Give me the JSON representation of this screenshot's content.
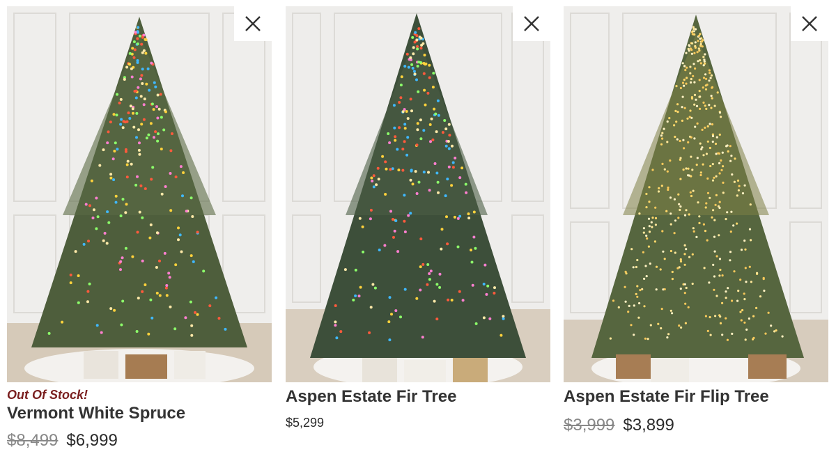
{
  "products": [
    {
      "stock_status": "Out Of Stock!",
      "name": "Vermont White Spruce",
      "old_price": "$8,499",
      "price": "$6,999",
      "image_alt": "Vermont White Spruce",
      "light_style": "multicolor"
    },
    {
      "stock_status": "",
      "name": "Aspen Estate Fir Tree",
      "old_price": "",
      "price": "$5,299",
      "image_alt": "Aspen Estate Fir Tree",
      "light_style": "multicolor"
    },
    {
      "stock_status": "",
      "name": "Aspen Estate Fir Flip Tree",
      "old_price": "$3,999",
      "price": "$3,899",
      "image_alt": "Aspen Estate Fir Flip Tree",
      "light_style": "warm-white"
    }
  ],
  "icons": {
    "remove": "close-icon"
  },
  "colors": {
    "out_of_stock": "#7a1f1f",
    "tree_green": "#4a5e3a",
    "wall": "#eeedeb",
    "floor": "#d8cdbf"
  }
}
